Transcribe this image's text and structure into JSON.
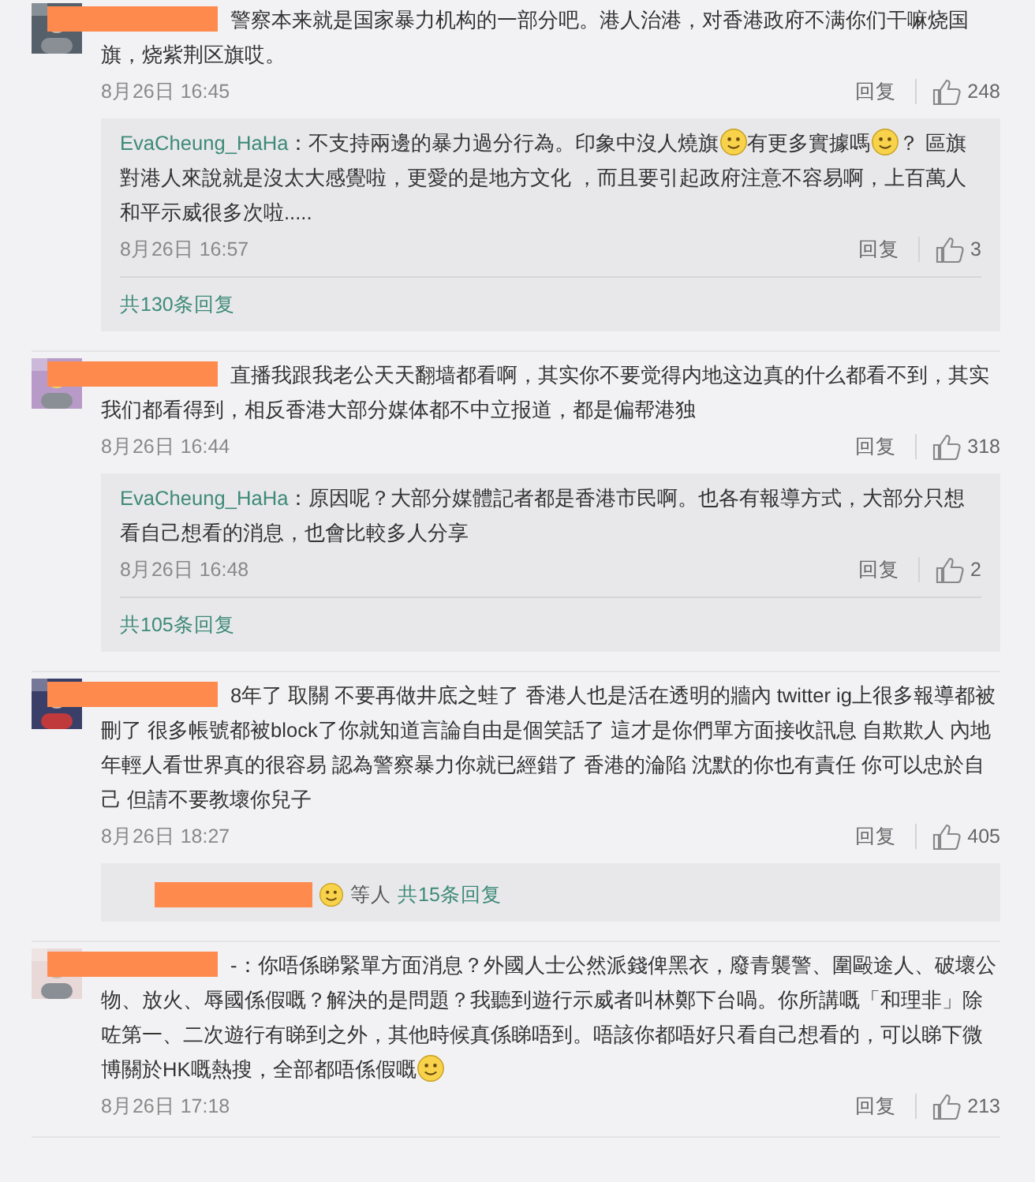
{
  "comments": [
    {
      "body": [
        {
          "kind": "text",
          "text": "警察本来就是国家暴力机构的一部分吧。港人治港，对香港政府不满你们干嘛烧国旗，烧紫荆区旗哎。"
        }
      ],
      "date": "8月26日 16:45",
      "reply_label": "回复",
      "likes": "248",
      "replies": [
        {
          "user": "EvaCheung_HaHa",
          "body": [
            {
              "kind": "text",
              "text": "：不支持兩邊的暴力過分行為。印象中沒人燒旗"
            },
            {
              "kind": "emoji"
            },
            {
              "kind": "text",
              "text": "有更多實據嗎"
            },
            {
              "kind": "emoji"
            },
            {
              "kind": "text",
              "text": "？ 區旗對港人來說就是沒太大感覺啦，更愛的是地方文化 ，而且要引起政府注意不容易啊，上百萬人和平示威很多次啦....."
            }
          ],
          "date": "8月26日 16:57",
          "reply_label": "回复",
          "likes": "3"
        }
      ],
      "more": "共130条回复"
    },
    {
      "body": [
        {
          "kind": "text",
          "text": "直播我跟我老公天天翻墙都看啊，其实你不要觉得内地这边真的什么都看不到，其实我们都看得到，相反香港大部分媒体都不中立报道，都是偏帮港独"
        }
      ],
      "date": "8月26日 16:44",
      "reply_label": "回复",
      "likes": "318",
      "replies": [
        {
          "user": "EvaCheung_HaHa",
          "body": [
            {
              "kind": "text",
              "text": "：原因呢？大部分媒體記者都是香港市民啊。也各有報導方式，大部分只想看自己想看的消息，也會比較多人分享"
            }
          ],
          "date": "8月26日 16:48",
          "reply_label": "回复",
          "likes": "2"
        }
      ],
      "more": "共105条回复"
    },
    {
      "body": [
        {
          "kind": "text",
          "text": "8年了 取關 不要再做井底之蛙了 香港人也是活在透明的牆內  twitter ig上很多報導都被刪了 很多帳號都被block了你就知道言論自由是個笑話了 這才是你們單方面接收訊息 自欺欺人 內地年輕人看世界真的很容易 認為警察暴力你就已經錯了 香港的淪陷 沈默的你也有責任 你可以忠於自己 但請不要教壞你兒子"
        }
      ],
      "date": "8月26日 18:27",
      "reply_label": "回复",
      "likes": "405",
      "summary": {
        "suffix": "等人",
        "more": "共15条回复"
      }
    },
    {
      "body": [
        {
          "kind": "text",
          "text": "-：你唔係睇緊單方面消息？外國人士公然派錢俾黑衣，廢青襲警、圍毆途人、破壞公物、放火、辱國係假嘅？解決的是問題？我聽到遊行示威者叫林鄭下台喎。你所講嘅「和理非」除咗第一、二次遊行有睇到之外，其他時候真係睇唔到。唔該你都唔好只看自己想看的，可以睇下微博關於HK嘅熱搜，全部都唔係假嘅"
        },
        {
          "kind": "emoji"
        }
      ],
      "date": "8月26日 17:18",
      "reply_label": "回复",
      "likes": "213"
    }
  ]
}
